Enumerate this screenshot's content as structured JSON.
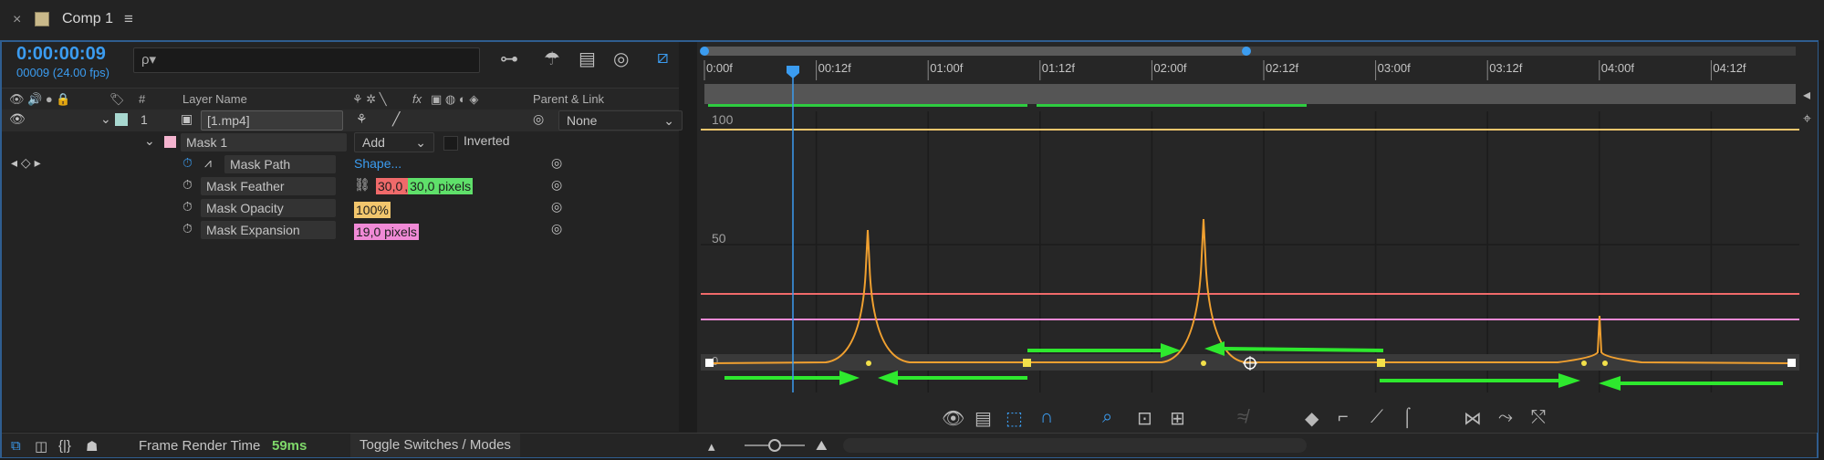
{
  "tab": {
    "close": "×",
    "title": "Comp 1",
    "menu": "≡"
  },
  "time": {
    "timecode": "0:00:00:09",
    "frames": "00009 (24.00 fps)"
  },
  "search": {
    "icon": "ρ▾",
    "placeholder": ""
  },
  "columns": {
    "number": "#",
    "layer_name": "Layer Name",
    "parent": "Parent & Link",
    "fx": "fx"
  },
  "layer": {
    "index": "1",
    "name": "[1.mp4]",
    "parent": "None"
  },
  "mask": {
    "name": "Mask 1",
    "mode": "Add",
    "inverted": "Inverted"
  },
  "properties": [
    {
      "name": "Mask Path",
      "value": "Shape..."
    },
    {
      "name": "Mask Feather",
      "value_a": "30,0",
      "value_sep": ",",
      "value_b": "30,0 pixels"
    },
    {
      "name": "Mask Opacity",
      "value": "100%"
    },
    {
      "name": "Mask Expansion",
      "value": "19,0 pixels"
    }
  ],
  "ruler": {
    "labels": [
      "0:00f",
      "00:12f",
      "01:00f",
      "01:12f",
      "02:00f",
      "02:12f",
      "03:00f",
      "03:12f",
      "04:00f",
      "04:12f"
    ]
  },
  "graph_labels": {
    "top": "100",
    "mid": "50",
    "zero": "0"
  },
  "status": {
    "frame_render_label": "Frame Render Time",
    "frame_render_value": "59ms",
    "toggle": "Toggle Switches / Modes"
  },
  "colors": {
    "accent": "#3b9cf0",
    "feather_red": "#f06a6a",
    "feather_green": "#5fe06a",
    "opacity_yellow": "#f2c66d",
    "expansion_pink": "#f08ad6",
    "curve_orange": "#f0a030",
    "arrow_green": "#2ee82e"
  }
}
